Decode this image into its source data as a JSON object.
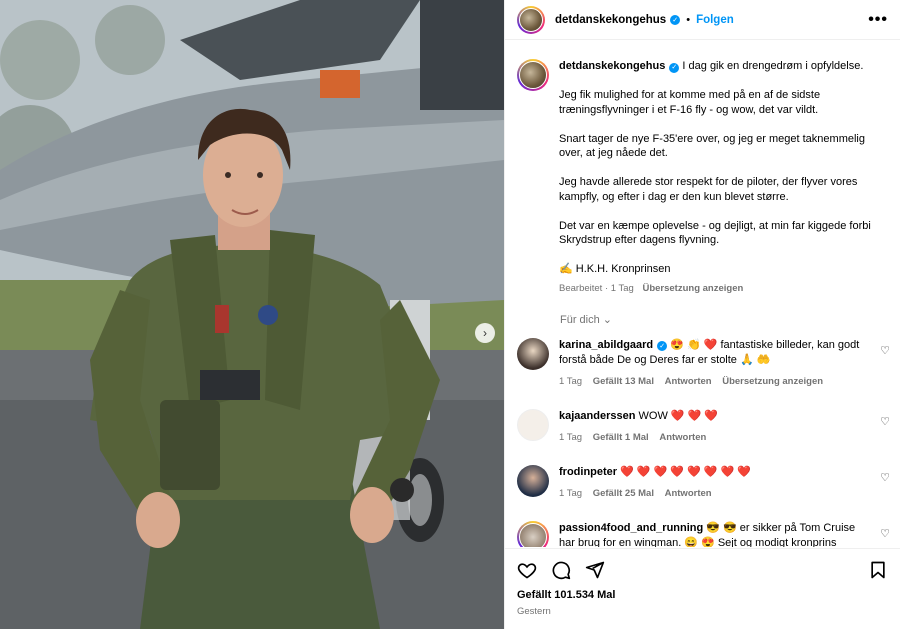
{
  "post": {
    "username": "detdanskekongehus",
    "follow_label": "Folgen",
    "dot": "•",
    "more": "•••"
  },
  "caption": {
    "username": "detdanskekongehus",
    "lines": [
      "I dag gik en drengedrøm i opfyldelse.",
      "Jeg fik mulighed for at komme med på en af de sidste træningsflyvninger i et F-16 fly - og wow, det var vildt.",
      "Snart tager de nye F-35'ere over, og jeg er meget taknemmelig over, at jeg nåede det.",
      "Jeg havde allerede stor respekt for de piloter, der flyver vores kampfly, og efter i dag er den kun blevet større.",
      "Det var en kæmpe oplevelse - og dejligt, at min far kiggede forbi Skrydstrup efter dagens flyvning.",
      "✍️ H.K.H. Kronprinsen"
    ],
    "edited": "Bearbeitet · 1 Tag",
    "translate": "Übersetzung anzeigen"
  },
  "fuer_dich": "Für dich ⌄",
  "comments": [
    {
      "user": "karina_abildgaard",
      "verified": true,
      "text": "😍 👏 ❤️ fantastiske billeder, kan godt forstå både De og Deres far er stolte 🙏 🤲",
      "time": "1 Tag",
      "likes": "Gefällt 13 Mal",
      "reply": "Antworten",
      "translate": "Übersetzung anzeigen"
    },
    {
      "user": "kajaanderssen",
      "verified": false,
      "text": "WOW ❤️ ❤️ ❤️",
      "time": "1 Tag",
      "likes": "Gefällt 1 Mal",
      "reply": "Antworten",
      "translate": ""
    },
    {
      "user": "frodinpeter",
      "verified": false,
      "text": "❤️ ❤️ ❤️ ❤️ ❤️ ❤️ ❤️ ❤️",
      "time": "1 Tag",
      "likes": "Gefällt 25 Mal",
      "reply": "Antworten",
      "translate": ""
    },
    {
      "user": "passion4food_and_running",
      "verified": false,
      "text": "😎 😎 er sikker på Tom Cruise har brug for en wingman. 😄 😍 Sejt og modigt kronprins Christian. Er sikker på at far ( konge) Frederik er stolt",
      "time": "",
      "likes": "",
      "reply": "",
      "translate": ""
    }
  ],
  "footer": {
    "likes": "Gefällt 101.534 Mal",
    "date": "Gestern"
  },
  "colors": {
    "link": "#0095f6",
    "muted": "#737373",
    "heart": "#ed4956"
  }
}
